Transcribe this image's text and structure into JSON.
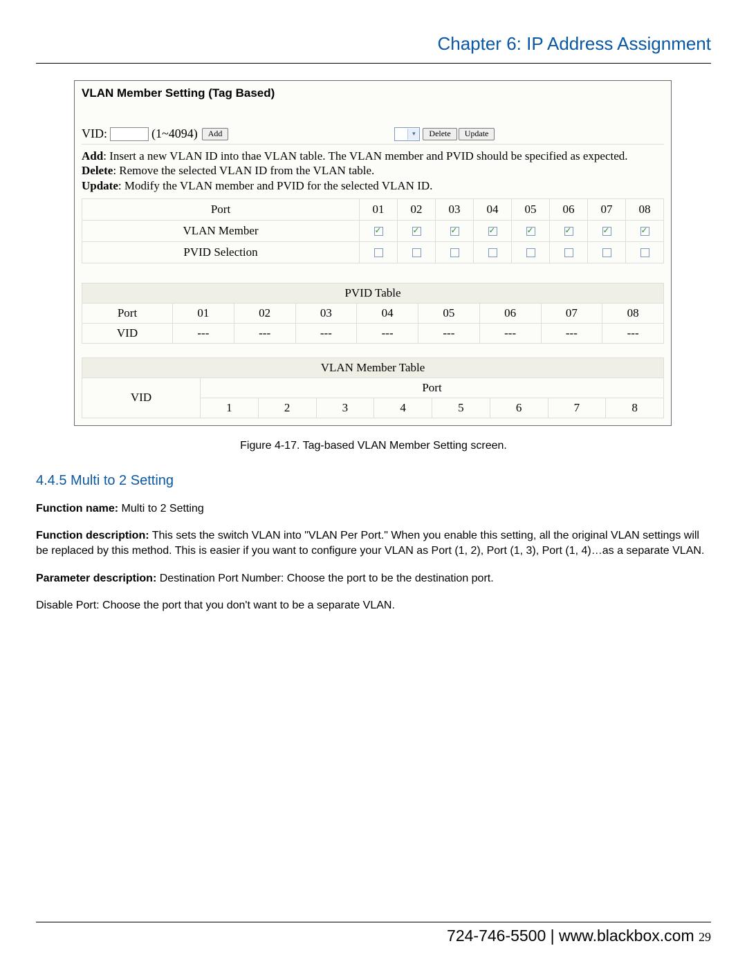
{
  "header": {
    "chapter_title": "Chapter 6: IP Address Assignment"
  },
  "panel": {
    "title": "VLAN Member Setting (Tag Based)",
    "vid_label": "VID:",
    "vid_value": "",
    "vid_range": "(1~4094)",
    "buttons": {
      "add": "Add",
      "delete": "Delete",
      "update": "Update"
    },
    "help": {
      "add_b": "Add",
      "add_t": ": Insert a new VLAN ID into thae VLAN table. The VLAN member and PVID should be specified as expected.",
      "delete_b": "Delete",
      "delete_t": ": Remove the selected VLAN ID from the VLAN table.",
      "update_b": "Update",
      "update_t": ": Modify the VLAN member and PVID for the selected VLAN ID."
    },
    "port_table": {
      "rows": {
        "port": "Port",
        "member": "VLAN Member",
        "pvid": "PVID Selection"
      },
      "ports": [
        "01",
        "02",
        "03",
        "04",
        "05",
        "06",
        "07",
        "08"
      ],
      "member_checked": [
        true,
        true,
        true,
        true,
        true,
        true,
        true,
        true
      ],
      "pvid_checked": [
        false,
        false,
        false,
        false,
        false,
        false,
        false,
        false
      ]
    },
    "pvid_table": {
      "header": "PVID Table",
      "port_label": "Port",
      "vid_label": "VID",
      "ports": [
        "01",
        "02",
        "03",
        "04",
        "05",
        "06",
        "07",
        "08"
      ],
      "vids": [
        "---",
        "---",
        "---",
        "---",
        "---",
        "---",
        "---",
        "---"
      ]
    },
    "member_table": {
      "header": "VLAN Member Table",
      "vid_label": "VID",
      "port_label": "Port",
      "ports": [
        "1",
        "2",
        "3",
        "4",
        "5",
        "6",
        "7",
        "8"
      ]
    }
  },
  "caption": "Figure 4-17. Tag-based VLAN Member Setting screen.",
  "section": {
    "heading": "4.4.5 Multi to 2 Setting",
    "fn_label": "Function name:",
    "fn_value": " Multi to 2 Setting",
    "fd_label": "Function description:",
    "fd_value": " This sets the switch VLAN into \"VLAN Per Port.\" When you enable this setting, all the original VLAN settings will be replaced by this method. This is easier if you want to configure your VLAN as Port (1, 2), Port (1, 3), Port (1, 4)…as a separate VLAN.",
    "pd_label": "Parameter description:",
    "pd_value": " Destination Port Number: Choose the port to be the destination port.",
    "disable": "Disable Port: Choose the port that you don't want to be a separate VLAN."
  },
  "footer": {
    "phone": "724-746-5500",
    "sep": "  |  ",
    "url": "www.blackbox.com",
    "page": "29"
  }
}
